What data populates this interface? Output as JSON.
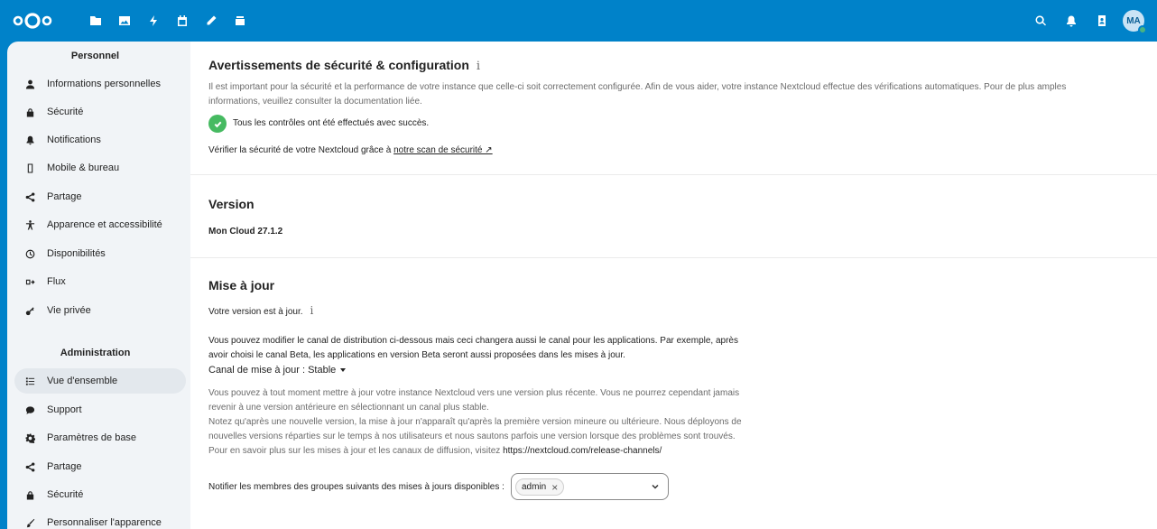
{
  "header": {
    "avatar_initials": "MA",
    "app_icons": [
      "files-icon",
      "photos-icon",
      "activity-icon",
      "calendar-icon",
      "notes-icon",
      "deck-icon"
    ],
    "right_icons": [
      "search-icon",
      "bell-icon",
      "contacts-icon"
    ],
    "colors": {
      "brand": "#0082c9",
      "status": "#49b382"
    }
  },
  "sidebar": {
    "personal_caption": "Personnel",
    "personal_items": [
      {
        "label": "Informations personnelles",
        "icon": "user-icon"
      },
      {
        "label": "Sécurité",
        "icon": "lock-icon"
      },
      {
        "label": "Notifications",
        "icon": "bell-icon"
      },
      {
        "label": "Mobile & bureau",
        "icon": "phone-icon"
      },
      {
        "label": "Partage",
        "icon": "share-icon"
      },
      {
        "label": "Apparence et accessibilité",
        "icon": "accessibility-icon"
      },
      {
        "label": "Disponibilités",
        "icon": "clock-icon"
      },
      {
        "label": "Flux",
        "icon": "flow-icon"
      },
      {
        "label": "Vie privée",
        "icon": "key-icon"
      }
    ],
    "admin_caption": "Administration",
    "admin_items": [
      {
        "label": "Vue d'ensemble",
        "icon": "list-icon",
        "active": true
      },
      {
        "label": "Support",
        "icon": "chat-icon"
      },
      {
        "label": "Paramètres de base",
        "icon": "gear-icon"
      },
      {
        "label": "Partage",
        "icon": "share-icon"
      },
      {
        "label": "Sécurité",
        "icon": "lock-icon"
      },
      {
        "label": "Personnaliser l'apparence",
        "icon": "brush-icon"
      }
    ]
  },
  "security": {
    "title": "Avertissements de sécurité & configuration",
    "info_glyph": "i",
    "intro_line1": "Il est important pour la sécurité et la performance de votre instance que celle-ci soit correctement configurée. Afin de vous aider, votre instance Nextcloud effectue des vérifications automatiques. Pour de plus amples",
    "intro_line2": "informations, veuillez consulter la documentation liée.",
    "ok_text": "Tous les contrôles ont été effectués avec succès.",
    "scan_prefix": "Vérifier la sécurité de votre Nextcloud grâce à ",
    "scan_link": "notre scan de sécurité ↗"
  },
  "version": {
    "title": "Version",
    "value": "Mon Cloud 27.1.2"
  },
  "update": {
    "title": "Mise à jour",
    "uptodate": "Votre version est à jour.",
    "info_glyph": "i",
    "channel_para1": "Vous pouvez modifier le canal de distribution ci-dessous mais ceci changera aussi le canal pour les applications. Par exemple, après",
    "channel_para2": "avoir choisi le canal Beta, les applications en version Beta seront aussi proposées dans les mises à jour.",
    "channel_label": "Canal de mise à jour :",
    "channel_value": "Stable",
    "help_lines": [
      "Vous pouvez à tout moment mettre à jour votre instance Nextcloud vers une version plus récente. Vous ne pourrez cependant jamais",
      "revenir à une version antérieure en sélectionnant un canal plus stable.",
      "Notez qu'après une nouvelle version, la mise à jour n'apparaît qu'après la première version mineure ou ultérieure. Nous déployons de",
      "nouvelles versions réparties sur le temps à nos utilisateurs et nous sautons parfois une version lorsque des problèmes sont trouvés."
    ],
    "more_prefix": "Pour en savoir plus sur les mises à jour et les canaux de diffusion, visitez ",
    "more_link": "https://nextcloud.com/release-channels/",
    "notify_label": "Notifier les membres des groupes suivants des mises à jours disponibles :",
    "notify_chip": "admin",
    "chip_remove": "×"
  }
}
